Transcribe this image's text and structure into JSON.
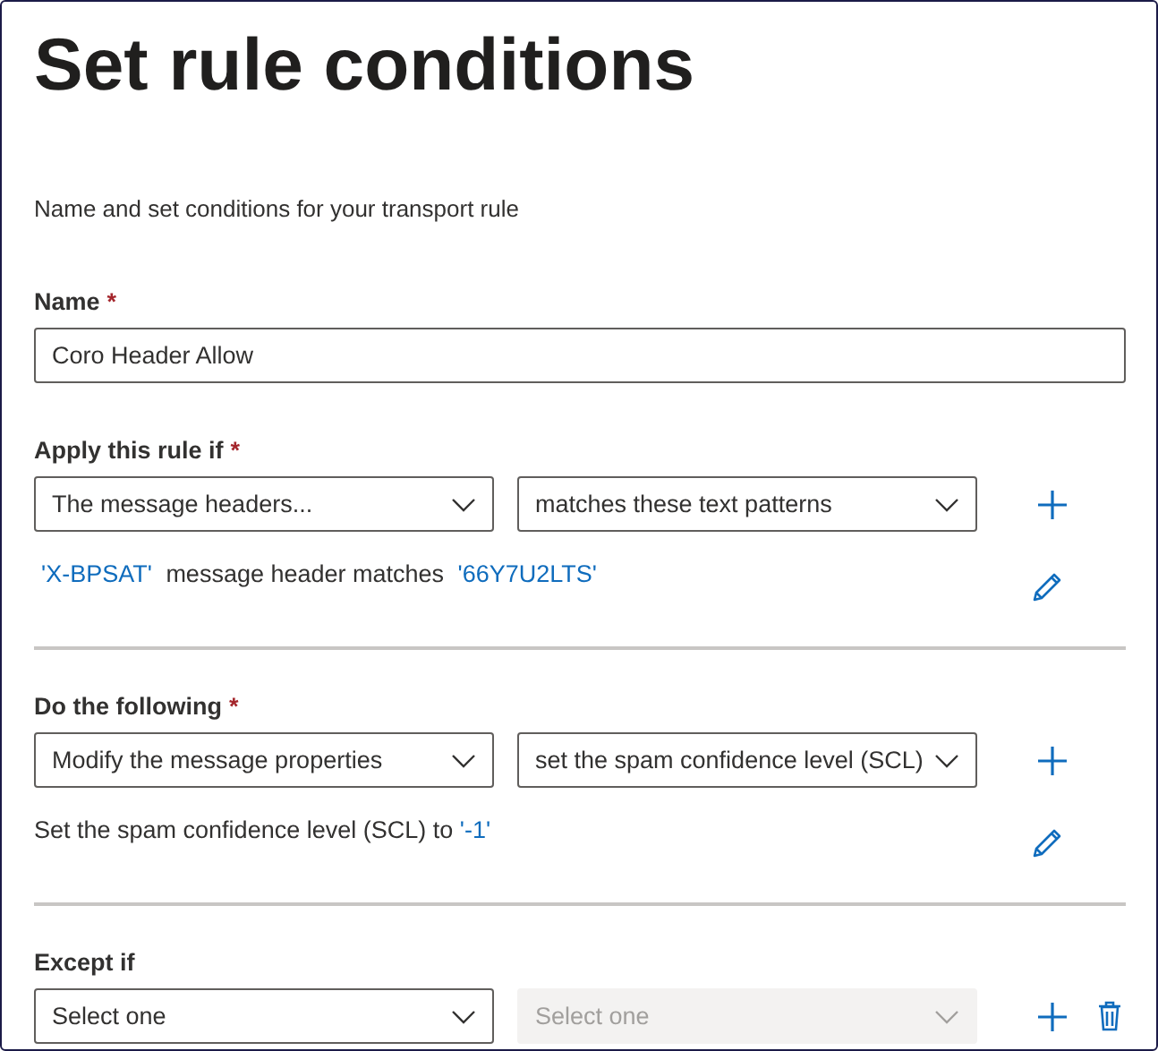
{
  "title": "Set rule conditions",
  "description": "Name and set conditions for your transport rule",
  "name_field": {
    "label": "Name",
    "required_mark": "*",
    "value": "Coro Header Allow"
  },
  "sections": [
    {
      "label": "Apply this rule if",
      "required_mark": "*",
      "dropdowns": [
        {
          "value": "The message headers...",
          "disabled": false
        },
        {
          "value": "matches these text patterns",
          "disabled": false
        }
      ],
      "tools": [
        {
          "kind": "add"
        }
      ],
      "summary": {
        "parts": [
          {
            "kind": "link",
            "text": "'X-BPSAT'"
          },
          {
            "kind": "plain",
            "text": "message header matches"
          },
          {
            "kind": "link",
            "text": "'66Y7U2LTS'"
          }
        ],
        "tools": [
          {
            "kind": "edit"
          }
        ]
      }
    },
    {
      "label": "Do the following",
      "required_mark": "*",
      "dropdowns": [
        {
          "value": "Modify the message properties",
          "disabled": false
        },
        {
          "value": "set the spam confidence level (SCL)",
          "disabled": false
        }
      ],
      "tools": [
        {
          "kind": "add"
        }
      ],
      "summary": {
        "parts": [
          {
            "kind": "plain",
            "text": "Set the spam confidence level (SCL) to"
          },
          {
            "kind": "link",
            "text": "'-1'"
          }
        ],
        "tools": [
          {
            "kind": "edit"
          }
        ]
      }
    },
    {
      "label": "Except if",
      "dropdowns": [
        {
          "value": "Select one",
          "disabled": false
        },
        {
          "value": "Select one",
          "disabled": true
        }
      ],
      "tools": [
        {
          "kind": "add"
        },
        {
          "kind": "delete"
        }
      ]
    }
  ]
}
